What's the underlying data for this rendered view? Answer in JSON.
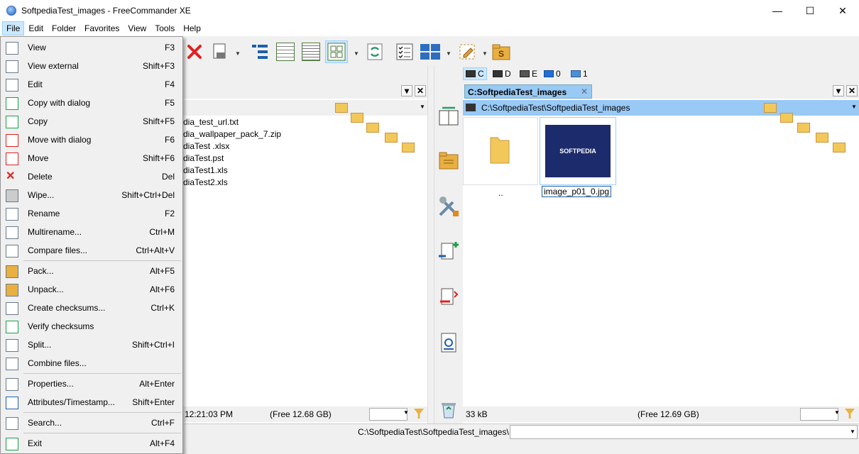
{
  "window": {
    "title": "SoftpediaTest_images - FreeCommander XE",
    "minimize": "—",
    "maximize": "☐",
    "close": "✕"
  },
  "menubar": {
    "items": [
      "File",
      "Edit",
      "Folder",
      "Favorites",
      "View",
      "Tools",
      "Help"
    ]
  },
  "file_menu": {
    "items": [
      {
        "label": "View",
        "shortcut": "F3"
      },
      {
        "label": "View external",
        "shortcut": "Shift+F3"
      },
      {
        "label": "Edit",
        "shortcut": "F4"
      },
      {
        "label": "Copy with dialog",
        "shortcut": "F5"
      },
      {
        "label": "Copy",
        "shortcut": "Shift+F5"
      },
      {
        "label": "Move with dialog",
        "shortcut": "F6"
      },
      {
        "label": "Move",
        "shortcut": "Shift+F6"
      },
      {
        "label": "Delete",
        "shortcut": "Del"
      },
      {
        "label": "Wipe...",
        "shortcut": "Shift+Ctrl+Del"
      },
      {
        "label": "Rename",
        "shortcut": "F2"
      },
      {
        "label": "Multirename...",
        "shortcut": "Ctrl+M"
      },
      {
        "label": "Compare files...",
        "shortcut": "Ctrl+Alt+V"
      },
      {
        "label": "Pack...",
        "shortcut": "Alt+F5"
      },
      {
        "label": "Unpack...",
        "shortcut": "Alt+F6"
      },
      {
        "label": "Create checksums...",
        "shortcut": "Ctrl+K"
      },
      {
        "label": "Verify checksums",
        "shortcut": ""
      },
      {
        "label": "Split...",
        "shortcut": "Shift+Ctrl+I"
      },
      {
        "label": "Combine files...",
        "shortcut": ""
      },
      {
        "label": "Properties...",
        "shortcut": "Alt+Enter"
      },
      {
        "label": "Attributes/Timestamp...",
        "shortcut": "Shift+Enter"
      },
      {
        "label": "Search...",
        "shortcut": "Ctrl+F"
      },
      {
        "label": "Exit",
        "shortcut": "Alt+F4"
      }
    ]
  },
  "left_panel": {
    "files": [
      "dia_test_url.txt",
      "dia_wallpaper_pack_7.zip",
      "diaTest .xlsx",
      "diaTest.pst",
      "diaTest1.xls",
      "diaTest2.xls"
    ],
    "status_time": "12:21:03 PM",
    "status_free": "(Free 12.68 GB)"
  },
  "right_panel": {
    "drives": [
      {
        "label": "C"
      },
      {
        "label": "D"
      },
      {
        "label": "E"
      },
      {
        "label": "0"
      },
      {
        "label": "1"
      }
    ],
    "tab_label": "C:SoftpediaTest_images",
    "path": "C:\\SoftpediaTest\\SoftpediaTest_images",
    "thumbnails": [
      {
        "label": ".."
      },
      {
        "label": "image_p01_0.jpg",
        "thumb_text": "SOFTPEDIA"
      }
    ],
    "status_size": "33 kB",
    "status_free": "(Free 12.69 GB)"
  },
  "bottom_bar": {
    "path": "C:\\SoftpediaTest\\SoftpediaTest_images\\"
  },
  "colors": {
    "menu_highlight": "#cce8ff",
    "path_bar_active": "#99c9f5",
    "thumb_bg": "#1c2b6b"
  }
}
